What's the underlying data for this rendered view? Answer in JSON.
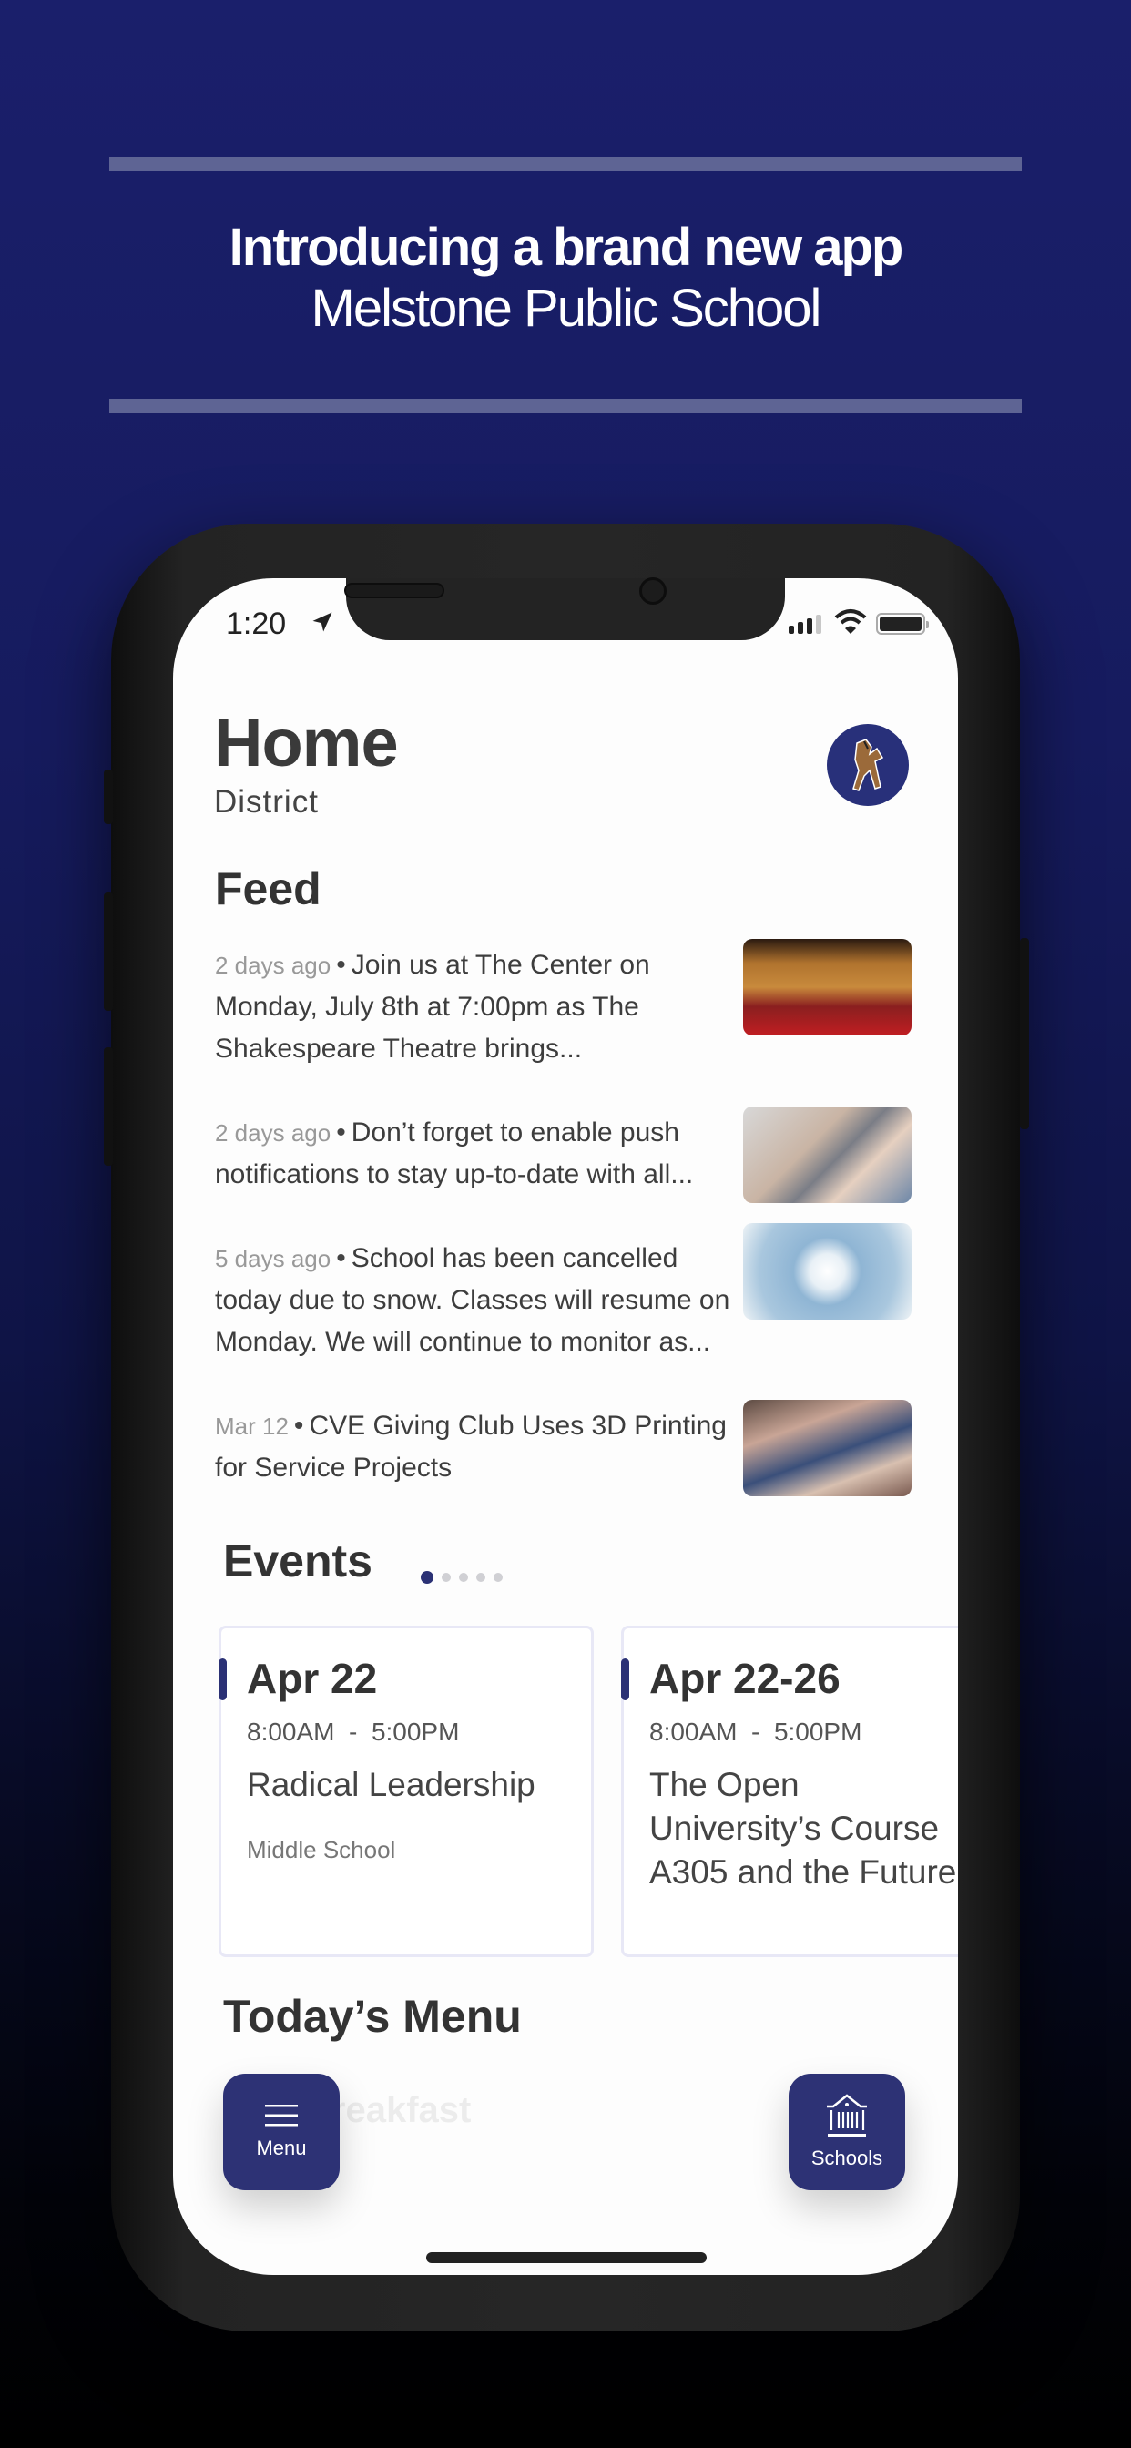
{
  "promo": {
    "headline": "Introducing a brand new app",
    "subheadline": "Melstone Public School"
  },
  "status_bar": {
    "time": "1:20",
    "signal_bars": 3,
    "signal_bars_total": 4,
    "battery_level": 1.0
  },
  "header": {
    "title": "Home",
    "subtitle": "District",
    "avatar_icon": "school-mascot-mustang-icon"
  },
  "feed": {
    "title": "Feed",
    "items": [
      {
        "time": "2 days ago",
        "text": "Join us at The Center on Monday, July 8th at 7:00pm as The Shakespeare Theatre brings...",
        "thumb": "theatre-seats-image"
      },
      {
        "time": "2 days ago",
        "text": "Don’t forget to enable push notifications to stay up-to-date with all...",
        "thumb": "phone-in-hand-image"
      },
      {
        "time": "5 days ago",
        "text": "School has been cancelled today due to snow. Classes will resume on Monday. We will continue to monitor as...",
        "thumb": "snowflake-mittens-image"
      },
      {
        "time": "Mar 12",
        "text": "CVE Giving Club Uses 3D Printing for Service Projects",
        "thumb": "classroom-image"
      }
    ]
  },
  "events": {
    "title": "Events",
    "page_count": 5,
    "active_page": 1,
    "items": [
      {
        "date": "Apr 22",
        "time": "8:00AM  -  5:00PM",
        "name": "Radical Leadership",
        "location": "Middle School"
      },
      {
        "date": "Apr 22-26",
        "time": "8:00AM  -  5:00PM",
        "name": "The Open University’s Course A305 and the Future",
        "location": ""
      }
    ]
  },
  "todays_menu": {
    "title": "Today’s Menu",
    "first_section": "Breakfast"
  },
  "fabs": {
    "menu_label": "Menu",
    "schools_label": "Schools"
  },
  "colors": {
    "brand": "#2d3275",
    "background_top": "#1a1f6b",
    "background_bottom": "#000000"
  }
}
